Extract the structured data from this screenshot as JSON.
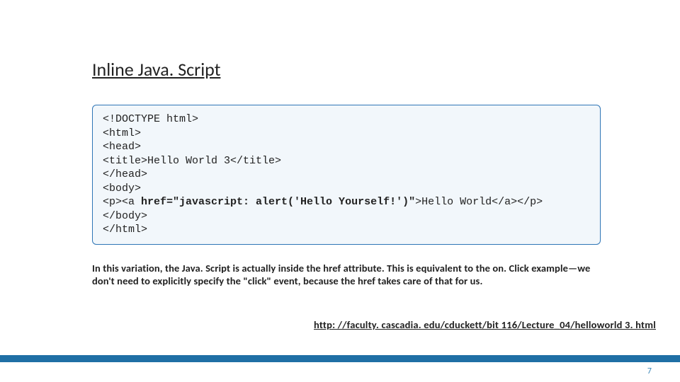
{
  "title": "Inline Java. Script",
  "code": {
    "l1": "<!DOCTYPE html>",
    "l2": "<html>",
    "l3": "<head>",
    "l4": "<title>Hello World 3</title>",
    "l5": "</head>",
    "l6": "<body>",
    "l7a": "<p><a ",
    "l7b": "href=\"javascript: alert('Hello Yourself!')\"",
    "l7c": ">Hello World</a></p>",
    "l8": "</body>",
    "l9": "</html>"
  },
  "desc": "In this variation, the Java. Script is actually inside the href attribute.  This is equivalent to the on. Click example—we don't need to explicitly specify  the \"click\" event, because the  href takes care of that for us.",
  "link": "http: //faculty. cascadia. edu/cduckett/bit 116/Lecture_04/helloworld 3. html",
  "pagenum": "7"
}
